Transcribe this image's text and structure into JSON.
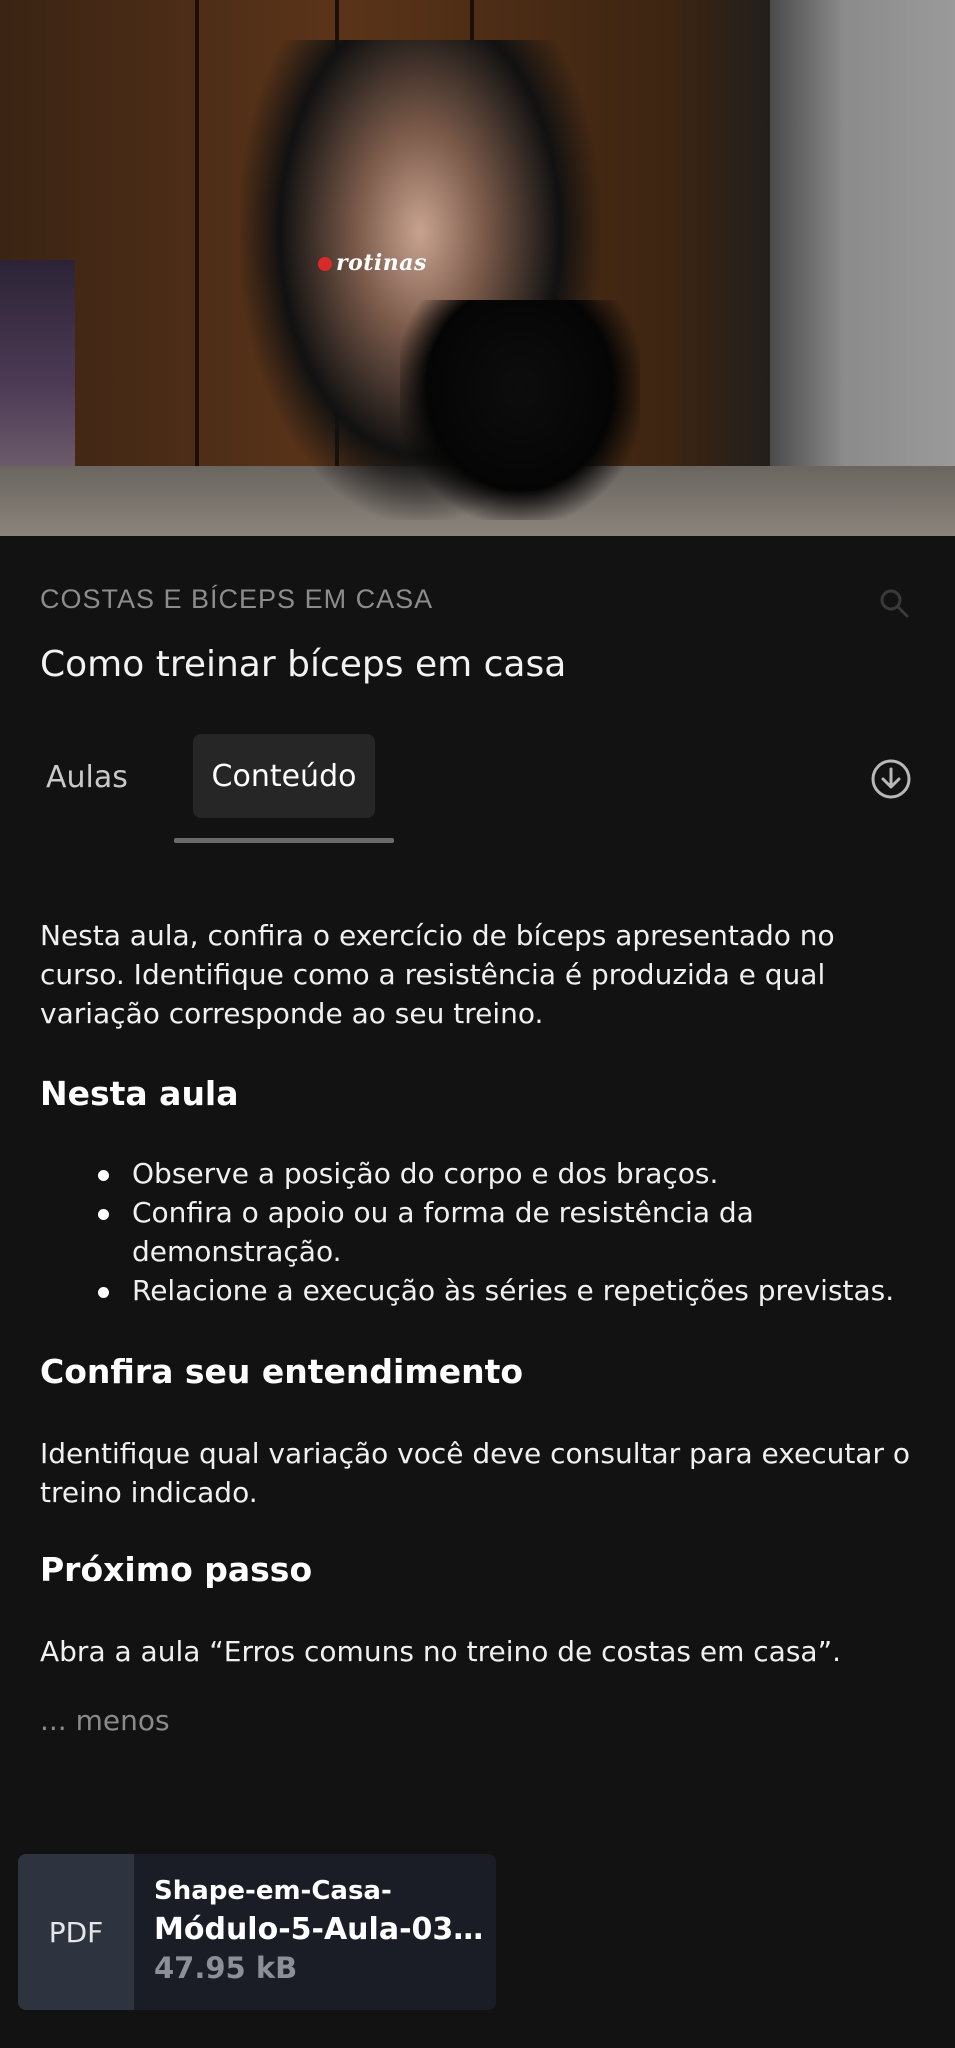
{
  "hero": {
    "watermark": "rotinas"
  },
  "course": {
    "label": "COSTAS E BÍCEPS EM CASA",
    "lesson_title": "Como treinar bíceps em casa"
  },
  "tabs": [
    {
      "label": "Aulas",
      "selected": false
    },
    {
      "label": "Conteúdo",
      "selected": true
    }
  ],
  "content": {
    "intro": "Nesta aula, confira o exercício de bíceps apresentado no curso. Identifique como a resistência é produzida e qual variação corresponde ao seu treino.",
    "section_nesta_aula": {
      "heading": "Nesta aula",
      "bullets": [
        "Observe a posição do corpo e dos braços.",
        "Confira o apoio ou a forma de resistência da demonstração.",
        "Relacione a execução às séries e repetições previstas."
      ]
    },
    "section_confira": {
      "heading": "Confira seu entendimento",
      "text": "Identifique qual variação você deve consultar para executar o treino indicado."
    },
    "section_proximo": {
      "heading": "Próximo passo",
      "text": "Abra a aula “Erros comuns no treino de costas em casa”."
    },
    "less_link": "... menos"
  },
  "attachment": {
    "type_label": "PDF",
    "name_line1": "Shape-em-Casa-",
    "name_line2": "Módulo-5-Aula-03-C...",
    "size": "47.95 kB"
  },
  "icons": {
    "search": "search-icon",
    "download": "download-circle-icon"
  }
}
